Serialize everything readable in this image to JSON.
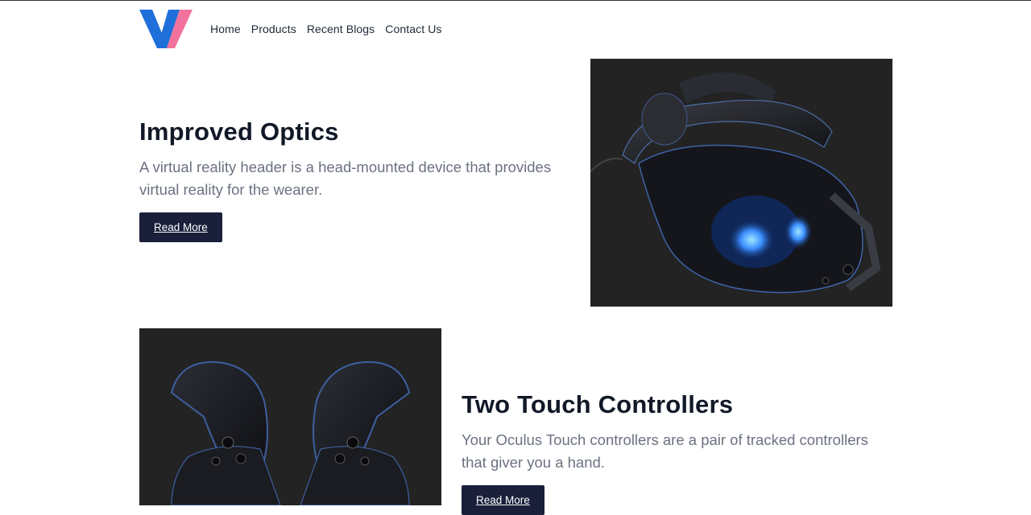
{
  "nav": {
    "items": [
      "Home",
      "Products",
      "Recent Blogs",
      "Contact Us"
    ]
  },
  "features": [
    {
      "title": "Improved Optics",
      "description": "A virtual reality header is a head-mounted device that provides virtual reality for the wearer.",
      "button_label": "Read More"
    },
    {
      "title": "Two Touch Controllers",
      "description": "Your Oculus Touch controllers are a pair of tracked controllers that giver you a hand.",
      "button_label": "Read More"
    }
  ],
  "colors": {
    "logo_blue": "#1e6fd9",
    "logo_pink": "#f06a97",
    "button_bg": "#1a1f3a",
    "image_bg": "#232324"
  }
}
